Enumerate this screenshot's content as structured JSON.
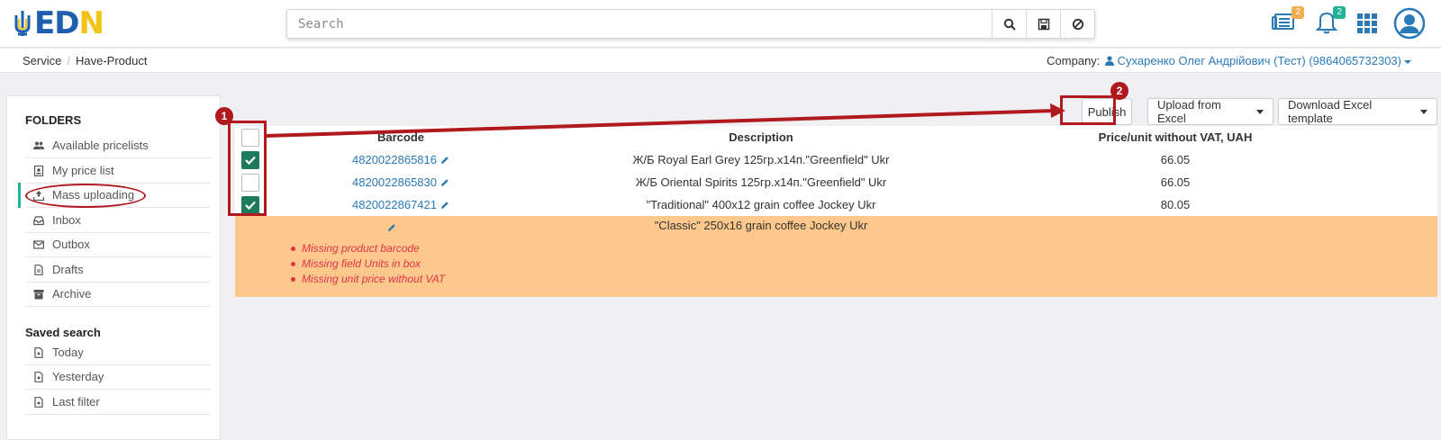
{
  "header": {
    "logo_letters": [
      "E",
      "D",
      "N"
    ],
    "search_placeholder": "Search",
    "icons": [
      "search-icon",
      "save-icon",
      "clear-icon",
      "news-icon",
      "bell-icon",
      "apps-grid-icon",
      "user-avatar-icon"
    ],
    "news_badge": "2",
    "bell_badge": "2"
  },
  "breadcrumb": {
    "items": [
      "Service",
      "Have-Product"
    ]
  },
  "company": {
    "label": "Company:",
    "value": "Сухаренко Олег Андрійович (Тест) (9864065732303)"
  },
  "sidebar": {
    "folders_heading": "FOLDERS",
    "folders": [
      {
        "label": "Available pricelists",
        "icon": "users-icon"
      },
      {
        "label": "My price list",
        "icon": "pricelist-icon"
      },
      {
        "label": "Mass uploading",
        "icon": "upload-icon",
        "active": true
      },
      {
        "label": "Inbox",
        "icon": "inbox-icon"
      },
      {
        "label": "Outbox",
        "icon": "envelope-icon"
      },
      {
        "label": "Drafts",
        "icon": "file-icon"
      },
      {
        "label": "Archive",
        "icon": "archive-icon"
      }
    ],
    "saved_heading": "Saved search",
    "saved": [
      {
        "label": "Today",
        "icon": "file-icon"
      },
      {
        "label": "Yesterday",
        "icon": "file-icon"
      },
      {
        "label": "Last filter",
        "icon": "file-icon"
      }
    ]
  },
  "toolbar": {
    "publish": "Publish",
    "upload": "Upload from Excel",
    "download": "Download Excel template"
  },
  "table": {
    "columns": [
      "Barcode",
      "Description",
      "Price/unit without VAT, UAH"
    ],
    "rows": [
      {
        "checked": true,
        "barcode": "4820022865816",
        "description": "Ж/Б Royal Earl Grey 125гр.x14п.\"Greenfield\" Ukr",
        "price": "66.05"
      },
      {
        "checked": false,
        "barcode": "4820022865830",
        "description": "Ж/Б Oriental Spirits 125гр.x14п.\"Greenfield\" Ukr",
        "price": "66.05"
      },
      {
        "checked": true,
        "barcode": "4820022867421",
        "description": "\"Traditional\" 400x12 grain coffee Jockey Ukr",
        "price": "80.05"
      }
    ],
    "error_row": {
      "description": "\"Classic\" 250x16 grain coffee Jockey Ukr",
      "errors": [
        "Missing product barcode",
        "Missing field Units in box",
        "Missing unit price without VAT"
      ]
    }
  },
  "annotations": {
    "step1": "1",
    "step2": "2",
    "color": "#b0191e"
  },
  "colors": {
    "accent_green": "#1fb294",
    "link_blue": "#2a7ab8",
    "error_bg": "#fdc88c",
    "error_text": "#e2324a"
  }
}
